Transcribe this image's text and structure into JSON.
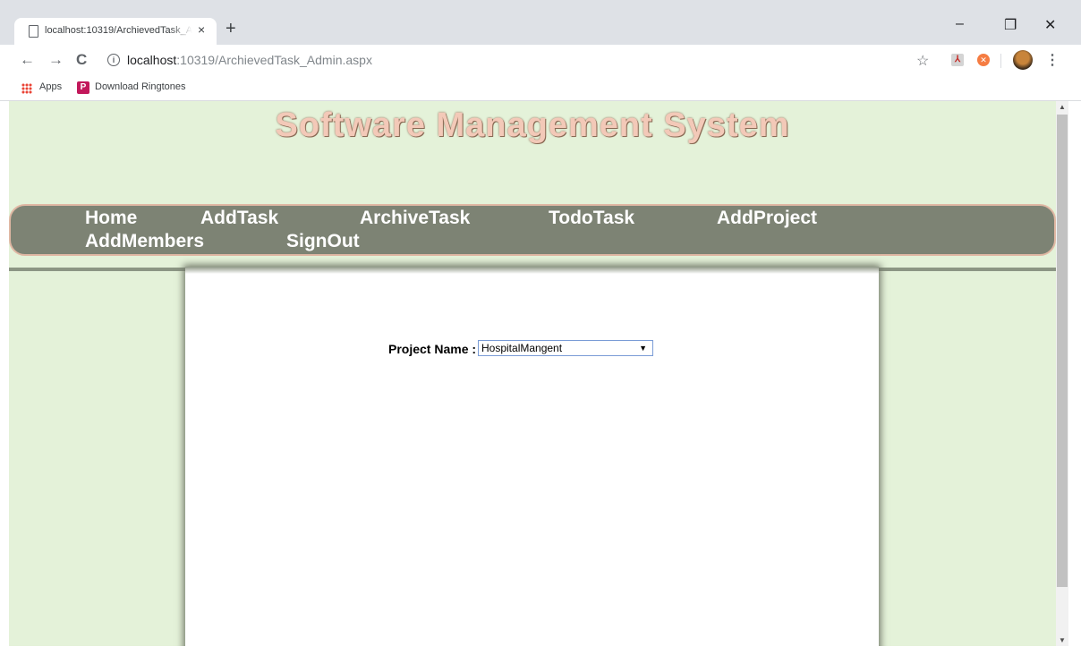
{
  "browser": {
    "tab_title": "localhost:10319/ArchievedTask_Admin.aspx",
    "tab_close": "×",
    "new_tab": "+",
    "url_host": "localhost",
    "url_rest": ":10319/ArchievedTask_Admin.aspx",
    "window_controls": {
      "minimize": "–",
      "restore": "❐",
      "close": "✕"
    },
    "nav": {
      "back": "←",
      "forward": "→",
      "reload": "C",
      "info": "i"
    },
    "star": "☆",
    "menu": "⋮",
    "bookmarks": [
      {
        "label": "Apps",
        "icon": "apps-grid-icon"
      },
      {
        "label": "Download Ringtones",
        "icon": "p-bookmark-icon",
        "icon_letter": "P"
      }
    ],
    "extensions": [
      {
        "name": "pdf-extension-icon",
        "glyph": "⅄"
      },
      {
        "name": "blocker-extension-icon",
        "glyph": "✕"
      }
    ]
  },
  "page": {
    "site_title": "Software Management System",
    "nav": [
      "Home",
      "AddTask",
      "ArchiveTask",
      "TodoTask",
      "AddProject",
      "AddMembers",
      "SignOut"
    ],
    "project_label": "Project Name :",
    "project_selected": "HospitalMangent",
    "select_arrow": "▼"
  },
  "scrollbar": {
    "up": "▲",
    "down": "▼"
  },
  "colors": {
    "page_background": "#e4f2d9",
    "nav_background": "#7d8374",
    "nav_border": "#e0b8a4",
    "title_color": "#f3c9b8"
  }
}
